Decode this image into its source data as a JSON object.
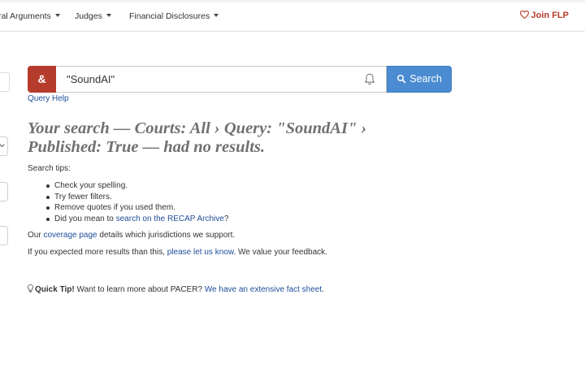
{
  "nav": {
    "items": [
      {
        "label": "ral Arguments"
      },
      {
        "label": "Judges"
      },
      {
        "label": "Financial Disclosures"
      }
    ],
    "join_label": "Join FLP"
  },
  "search": {
    "amp_label": "&",
    "value": "\"SoundAI\"",
    "button_label": "Search",
    "query_help": "Query Help"
  },
  "results": {
    "heading_prefix": "Your search — ",
    "heading_courts": "Courts: All",
    "heading_sep1": " › ",
    "heading_query": "Query: \"SoundAI\"",
    "heading_sep2": " › ",
    "heading_published": "Published: True",
    "heading_suffix": " — had no results."
  },
  "tips": {
    "title": "Search tips:",
    "items": [
      "Check your spelling.",
      "Try fewer filters.",
      "Remove quotes if you used them."
    ],
    "recap_prefix": "Did you mean to ",
    "recap_link": "search on the RECAP Archive",
    "recap_suffix": "?"
  },
  "coverage": {
    "prefix": "Our ",
    "link": "coverage page",
    "suffix": " details which jurisdictions we support."
  },
  "feedback": {
    "prefix": "If you expected more results than this, ",
    "link": "please let us know",
    "suffix": ". We value your feedback."
  },
  "quick_tip": {
    "label": "Quick Tip!",
    "text": " Want to learn more about PACER? ",
    "link": "We have an extensive fact sheet",
    "suffix": "."
  },
  "colors": {
    "brand_red": "#b53c2c",
    "search_blue": "#4a8bd1",
    "link_blue": "#1f4d99"
  }
}
